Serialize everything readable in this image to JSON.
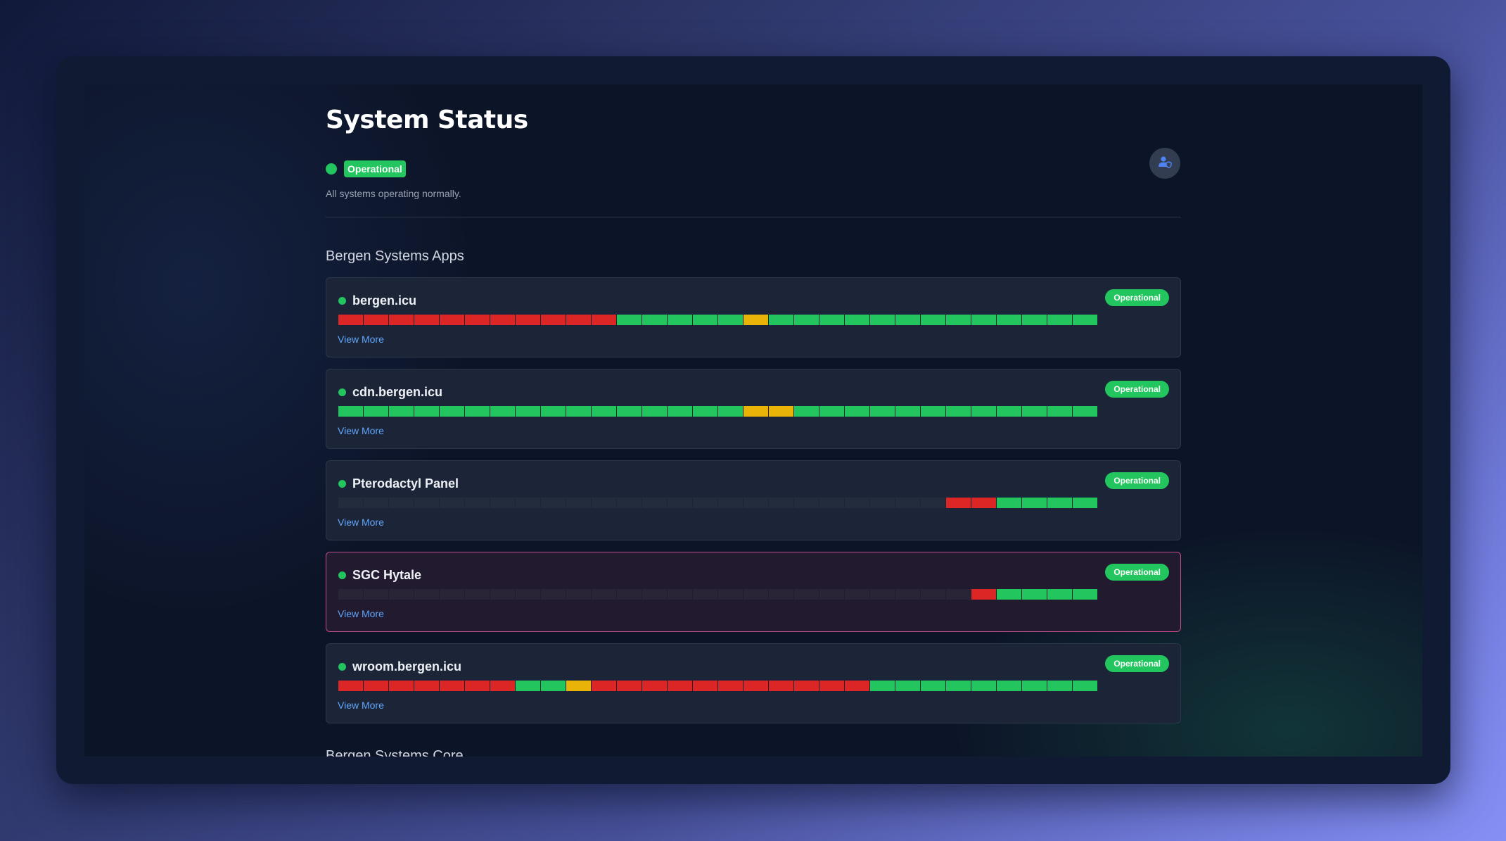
{
  "header": {
    "title": "System Status",
    "status_badge": "Operational",
    "subtitle": "All systems operating normally."
  },
  "colors": {
    "green": "#22c55e",
    "red": "#dc2626",
    "yellow": "#eab308",
    "none": "#222c3c",
    "link": "#60a5fa",
    "highlight_border": "#c04d8e"
  },
  "icons": {
    "profile": "user-shield-icon"
  },
  "sections": [
    {
      "title": "Bergen Systems Apps"
    },
    {
      "title": "Bergen Systems Core"
    }
  ],
  "legend_note": "bar codes: g=green (up), r=red (down), y=yellow (degraded), n=no data",
  "services": [
    {
      "name": "bergen.icu",
      "status": "Operational",
      "link": "View More",
      "bars": "rrrrrrrrrrrgggggyggggggggggggg"
    },
    {
      "name": "cdn.bergen.icu",
      "status": "Operational",
      "link": "View More",
      "bars": "ggggggggggggggggyygggggggggggg"
    },
    {
      "name": "Pterodactyl Panel",
      "status": "Operational",
      "link": "View More",
      "bars": "nnnnnnnnnnnnnnnnnnnnnnnnrrgggggg"
    },
    {
      "name": "SGC Hytale",
      "status": "Operational",
      "link": "View More",
      "bars": "nnnnnnnnnnnnnnnnnnnnnnnnnrgggg"
    },
    {
      "name": "wroom.bergen.icu",
      "status": "Operational",
      "link": "View More",
      "bars": "rrrrrrrggyrrrrrrrrrrrggggggggg"
    }
  ]
}
